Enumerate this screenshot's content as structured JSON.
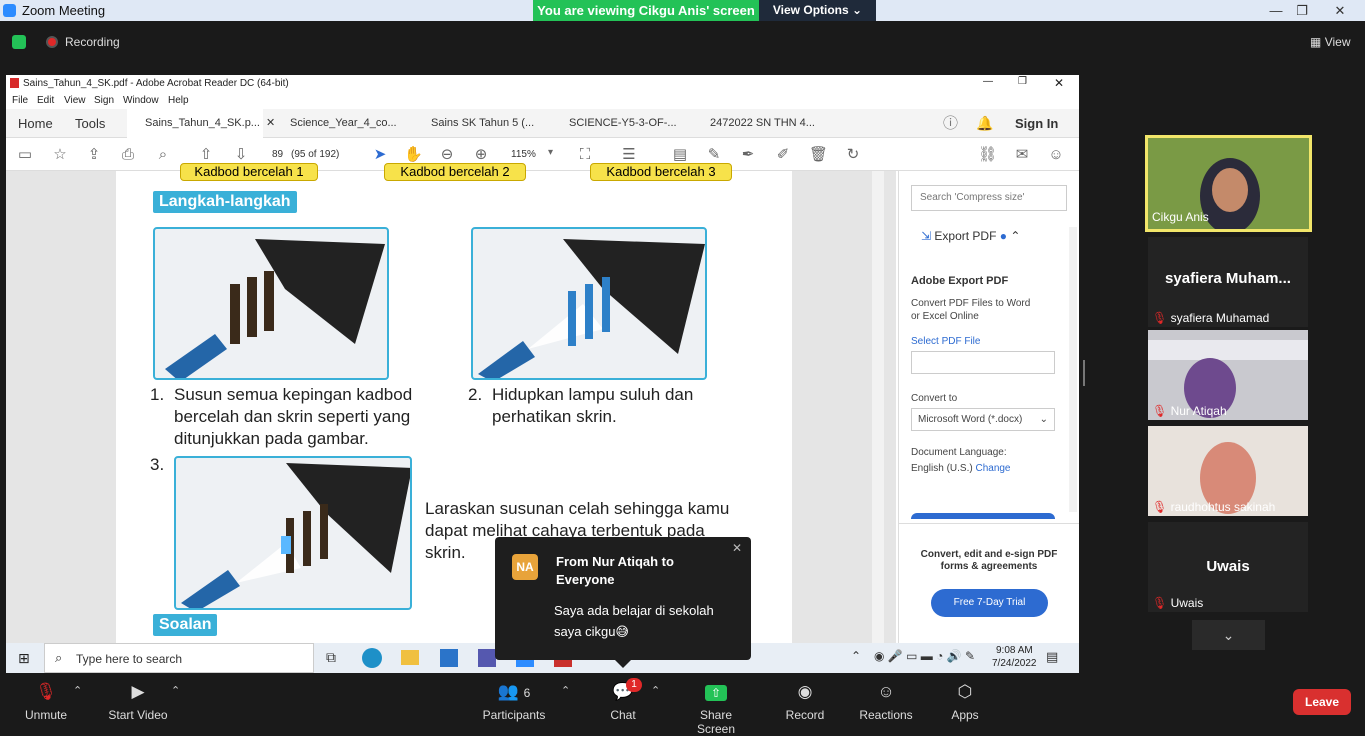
{
  "zoom": {
    "window_title": "Zoom Meeting",
    "viewing_banner": "You are viewing Cikgu Anis' screen",
    "view_options": "View Options",
    "recording": "Recording",
    "view": "View"
  },
  "acrobat": {
    "window_title": "Sains_Tahun_4_SK.pdf - Adobe Acrobat Reader DC (64-bit)",
    "menu": [
      "File",
      "Edit",
      "View",
      "Sign",
      "Window",
      "Help"
    ],
    "home": "Home",
    "tools": "Tools",
    "tabs": [
      "Sains_Tahun_4_SK.p...",
      "Science_Year_4_co...",
      "Sains SK Tahun 5 (...",
      "SCIENCE-Y5-3-OF-...",
      "2472022 SN THN 4..."
    ],
    "sign_in": "Sign In",
    "page_num": "89",
    "page_of": "(95 of 192)",
    "zoom": "115%",
    "right_pane": {
      "search_placeholder": "Search 'Compress size'",
      "export_pdf": "Export PDF",
      "adobe_export": "Adobe Export PDF",
      "convert_desc": "Convert PDF Files to Word or Excel Online",
      "select_file": "Select PDF File",
      "convert_to": "Convert to",
      "format": "Microsoft Word (*.docx)",
      "doc_lang": "Document Language:",
      "lang": "English (U.S.)",
      "change": "Change",
      "promo": "Convert, edit and e-sign PDF forms & agreements",
      "trial": "Free 7-Day Trial"
    }
  },
  "page": {
    "top_labels": [
      "Kadbod bercelah 1",
      "Kadbod bercelah 2",
      "Kadbod bercelah 3"
    ],
    "heading": "Langkah-langkah",
    "step1_num": "1.",
    "step1": "Susun semua kepingan kadbod bercelah dan skrin seperti yang ditunjukkan pada gambar.",
    "step2_num": "2.",
    "step2": "Hidupkan lampu suluh dan perhatikan skrin.",
    "step3_num": "3.",
    "step3": "Laraskan susunan celah sehingga kamu dapat melihat cahaya terbentuk pada skrin.",
    "soalan": "Soalan"
  },
  "taskbar": {
    "search": "Type here to search",
    "time": "9:08 AM",
    "date": "7/24/2022"
  },
  "chat_popup": {
    "initials": "NA",
    "from": "From Nur Atiqah to Everyone",
    "message": "Saya ada belajar di sekolah saya cikgu",
    "emoji": "😅"
  },
  "participants": [
    {
      "name": "Cikgu Anis"
    },
    {
      "big": "syafiera  Muham...",
      "name": "syafiera Muhamad"
    },
    {
      "name": "Nur Atiqah"
    },
    {
      "name": "raudhohtus sakinah"
    },
    {
      "big": "Uwais",
      "name": "Uwais"
    }
  ],
  "bottom": {
    "unmute": "Unmute",
    "start_video": "Start Video",
    "participants": "Participants",
    "participants_count": "6",
    "chat": "Chat",
    "chat_badge": "1",
    "share": "Share Screen",
    "record": "Record",
    "reactions": "Reactions",
    "apps": "Apps",
    "leave": "Leave"
  }
}
